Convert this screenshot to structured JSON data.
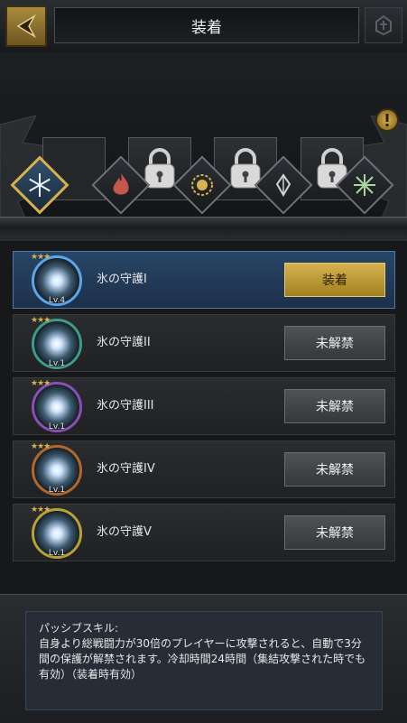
{
  "header": {
    "title": "装着"
  },
  "skills": [
    {
      "name": "氷の守護I",
      "level": "Lv.4",
      "button": "装着",
      "ring": "#5aa6e8"
    },
    {
      "name": "氷の守護II",
      "level": "Lv.1",
      "button": "未解禁",
      "ring": "#3f9c84"
    },
    {
      "name": "氷の守護III",
      "level": "Lv.1",
      "button": "未解禁",
      "ring": "#8a4fb6"
    },
    {
      "name": "氷の守護IV",
      "level": "Lv.1",
      "button": "未解禁",
      "ring": "#b0682c"
    },
    {
      "name": "氷の守護V",
      "level": "Lv.1",
      "button": "未解禁",
      "ring": "#b9a233"
    }
  ],
  "description": {
    "heading": "パッシブスキル:",
    "body": "自身より総戦闘力が30倍のプレイヤーに攻撃されると、自動で3分間の保護が解禁されます。冷却時間24時間（集結攻撃された時でも有効）（装着時有効）"
  }
}
